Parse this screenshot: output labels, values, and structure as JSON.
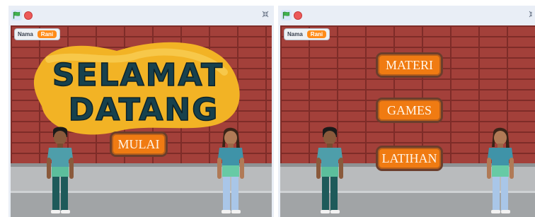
{
  "left_stage": {
    "variable": {
      "name": "Nama",
      "value": "Rani"
    },
    "title": {
      "line1": "SELAMAT",
      "line2": "DATANG"
    },
    "start_button": "MULAI"
  },
  "right_stage": {
    "variable": {
      "name": "Nama",
      "value": "Rani"
    },
    "menu": [
      "MATERI",
      "GAMES",
      "LATIHAN"
    ]
  },
  "icons": {
    "green_flag": "green-flag-icon",
    "stop": "stop-icon",
    "fullscreen": "fullscreen-icon"
  },
  "colors": {
    "button": "#f07b12",
    "title_burst": "#f2b325",
    "title_letters": "#17414d",
    "brick": "#a3403a"
  }
}
